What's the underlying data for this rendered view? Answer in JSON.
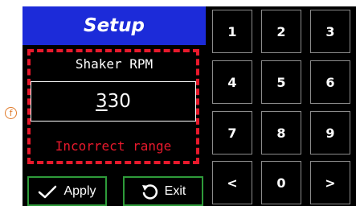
{
  "annotation_marker": "f",
  "header": {
    "title": "Setup"
  },
  "parameter": {
    "label": "Shaker RPM",
    "value_first_digit": "3",
    "value_rest": "30"
  },
  "status": {
    "error": "Incorrect range"
  },
  "buttons": {
    "apply": {
      "label": "Apply",
      "icon": "checkmark-icon"
    },
    "exit": {
      "label": "Exit",
      "icon": "undo-arrow-icon"
    }
  },
  "keypad": {
    "keys": [
      "1",
      "2",
      "3",
      "4",
      "5",
      "6",
      "7",
      "8",
      "9",
      "<",
      "0",
      ">"
    ]
  },
  "colors": {
    "header_bg": "#1c2bd9",
    "error_red": "#e8192c",
    "button_border_green": "#2e9b3a",
    "marker_orange": "#e07a2a"
  }
}
